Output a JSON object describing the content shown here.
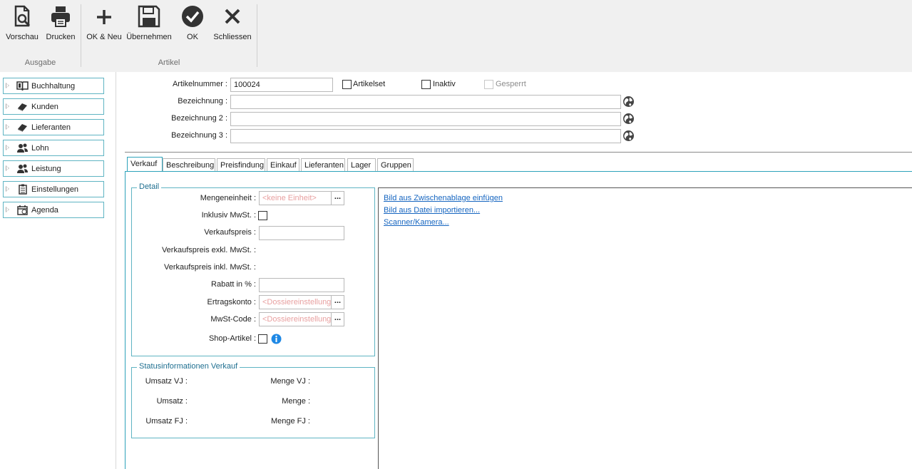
{
  "ribbon": {
    "buttons": [
      {
        "id": "preview",
        "label": "Vorschau",
        "icon": "preview-icon"
      },
      {
        "id": "print",
        "label": "Drucken",
        "icon": "printer-icon"
      },
      {
        "id": "ok_new",
        "label": "OK & Neu",
        "icon": "plus-icon"
      },
      {
        "id": "apply",
        "label": "Übernehmen",
        "icon": "save-icon"
      },
      {
        "id": "ok",
        "label": "OK",
        "icon": "checkmark-icon"
      },
      {
        "id": "close",
        "label": "Schliessen",
        "icon": "close-icon"
      }
    ],
    "groups": {
      "output": "Ausgabe",
      "article": "Artikel"
    }
  },
  "nav": {
    "items": [
      {
        "label": "Buchhaltung",
        "icon": "book-icon"
      },
      {
        "label": "Kunden",
        "icon": "notebook-icon"
      },
      {
        "label": "Lieferanten",
        "icon": "notebook-icon"
      },
      {
        "label": "Lohn",
        "icon": "people-icon"
      },
      {
        "label": "Leistung",
        "icon": "people-icon"
      },
      {
        "label": "Einstellungen",
        "icon": "clipboard-icon"
      },
      {
        "label": "Agenda",
        "icon": "calendar-icon"
      }
    ]
  },
  "header": {
    "article_number_label": "Artikelnummer :",
    "article_number_value": "100024",
    "articleset_label": "Artikelset",
    "inactive_label": "Inaktiv",
    "locked_label": "Gesperrt",
    "designation_label": "Bezeichnung :",
    "designation2_label": "Bezeichnung 2 :",
    "designation3_label": "Bezeichnung 3 :",
    "designation_value": "",
    "designation2_value": "",
    "designation3_value": ""
  },
  "tabs": [
    "Verkauf",
    "Beschreibung",
    "Preisfindung",
    "Einkauf",
    "Lieferanten",
    "Lager",
    "Gruppen"
  ],
  "detail": {
    "title": "Detail",
    "unit_label": "Mengeneinheit :",
    "unit_placeholder": "<keine Einheit>",
    "incl_vat_label": "Inklusiv MwSt. :",
    "sales_price_label": "Verkaufspreis :",
    "sales_price_value": "",
    "price_excl_label": "Verkaufspreis exkl. MwSt. :",
    "price_incl_label": "Verkaufspreis inkl. MwSt. :",
    "discount_label": "Rabatt in % :",
    "discount_value": "",
    "revenue_account_label": "Ertragskonto :",
    "revenue_account_placeholder": "<Dossiereinstellungen>",
    "vat_code_label": "MwSt-Code :",
    "vat_code_placeholder": "<Dossiereinstellungen>",
    "shop_article_label": "Shop-Artikel :",
    "dots": "..."
  },
  "status": {
    "title": "Statusinformationen Verkauf",
    "turnover_py_label": "Umsatz VJ :",
    "quantity_py_label": "Menge VJ :",
    "turnover_label": "Umsatz :",
    "quantity_label": "Menge :",
    "turnover_fy_label": "Umsatz FJ :",
    "quantity_fy_label": "Menge FJ :"
  },
  "image_pane": {
    "paste_link": "Bild aus Zwischenablage einfügen",
    "import_link": "Bild aus Datei importieren...",
    "scanner_link": "Scanner/Kamera..."
  },
  "colors": {
    "accent": "#2da2ba",
    "link": "#1565c0",
    "placeholder": "#e8a0a0",
    "info": "#1e88e5"
  }
}
